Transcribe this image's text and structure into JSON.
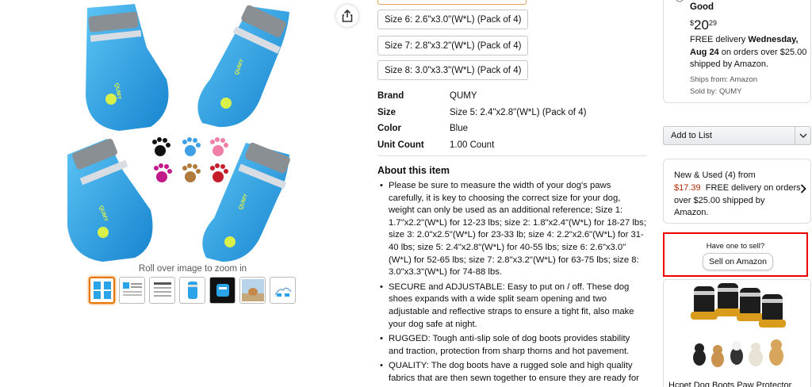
{
  "gallery": {
    "zoom_hint": "Roll over image to zoom in",
    "thumbnail_count": 7,
    "selected_thumbnail": 1,
    "boot_brand_print": "QUMY"
  },
  "size_options": [
    "Size 6: 2.6\"x3.0\"(W*L) (Pack of 4)",
    "Size 7: 2.8\"x3.2\"(W*L) (Pack of 4)",
    "Size 8: 3.0\"x3.3\"(W*L) (Pack of 4)"
  ],
  "attributes": [
    {
      "key": "Brand",
      "value": "QUMY"
    },
    {
      "key": "Size",
      "value": "Size 5: 2.4\"x2.8\"(W*L) (Pack of 4)"
    },
    {
      "key": "Color",
      "value": "Blue"
    },
    {
      "key": "Unit Count",
      "value": "1.00 Count"
    }
  ],
  "about": {
    "title": "About this item",
    "bullets": [
      "Please be sure to measure the width of your dog's paws carefully, it is key to choosing the correct size for your dog, weight can only be used as an additional reference; Size 1: 1.7\"x2.2\"(W*L) for 12-23 lbs; size 2: 1.8\"x2.4\"(W*L) for 18-27 lbs; size 3: 2.0\"x2.5\"(W*L) for 23-33 lb; size 4: 2.2\"x2.6\"(W*L) for 31-40 lbs; size 5: 2.4\"x2.8\"(W*L) for 40-55 lbs; size 6: 2.6\"x3.0\"(W*L) for 52-65 lbs; size 7: 2.8\"x3.2\"(W*L) for 63-75 lbs; size 8: 3.0\"x3.3\"(W*L) for 74-88 lbs.",
      "SECURE and ADJUSTABLE: Easy to put on / off. These dog shoes expands with a wide split seam opening and two adjustable and reflective straps to ensure a tight fit, also make your dog safe at night.",
      "RUGGED: Tough anti-slip sole of dog boots provides stability and traction, protection from sharp thorns and hot pavement.",
      "QUALITY: The dog boots have a rugged sole and high quality fabrics that are then sewn together to ensure they are ready for your adventure."
    ]
  },
  "buybox": {
    "condition": "Good",
    "price_currency": "$",
    "price_whole": "20",
    "price_fraction": "29",
    "delivery_prefix": "FREE delivery ",
    "delivery_date": "Wednesday, Aug 24",
    "delivery_suffix": " on orders over $25.00 shipped by Amazon.",
    "ships_from": "Ships from: Amazon",
    "sold_by": "Sold by: QUMY"
  },
  "add_to_list": {
    "label": "Add to List"
  },
  "used": {
    "prefix": "New & Used (4) from",
    "price": "$17.39",
    "suffix": "FREE delivery on orders over $25.00 shipped by Amazon."
  },
  "sell": {
    "question": "Have one to sell?",
    "button": "Sell on Amazon"
  },
  "ad": {
    "title": "Hcpet Dog Boots Paw Protector"
  },
  "colors": {
    "boot_blue": "#2aa3e8",
    "price_red": "#b12704",
    "selected_orange": "#e77600",
    "highlight_red": "#e00000"
  }
}
